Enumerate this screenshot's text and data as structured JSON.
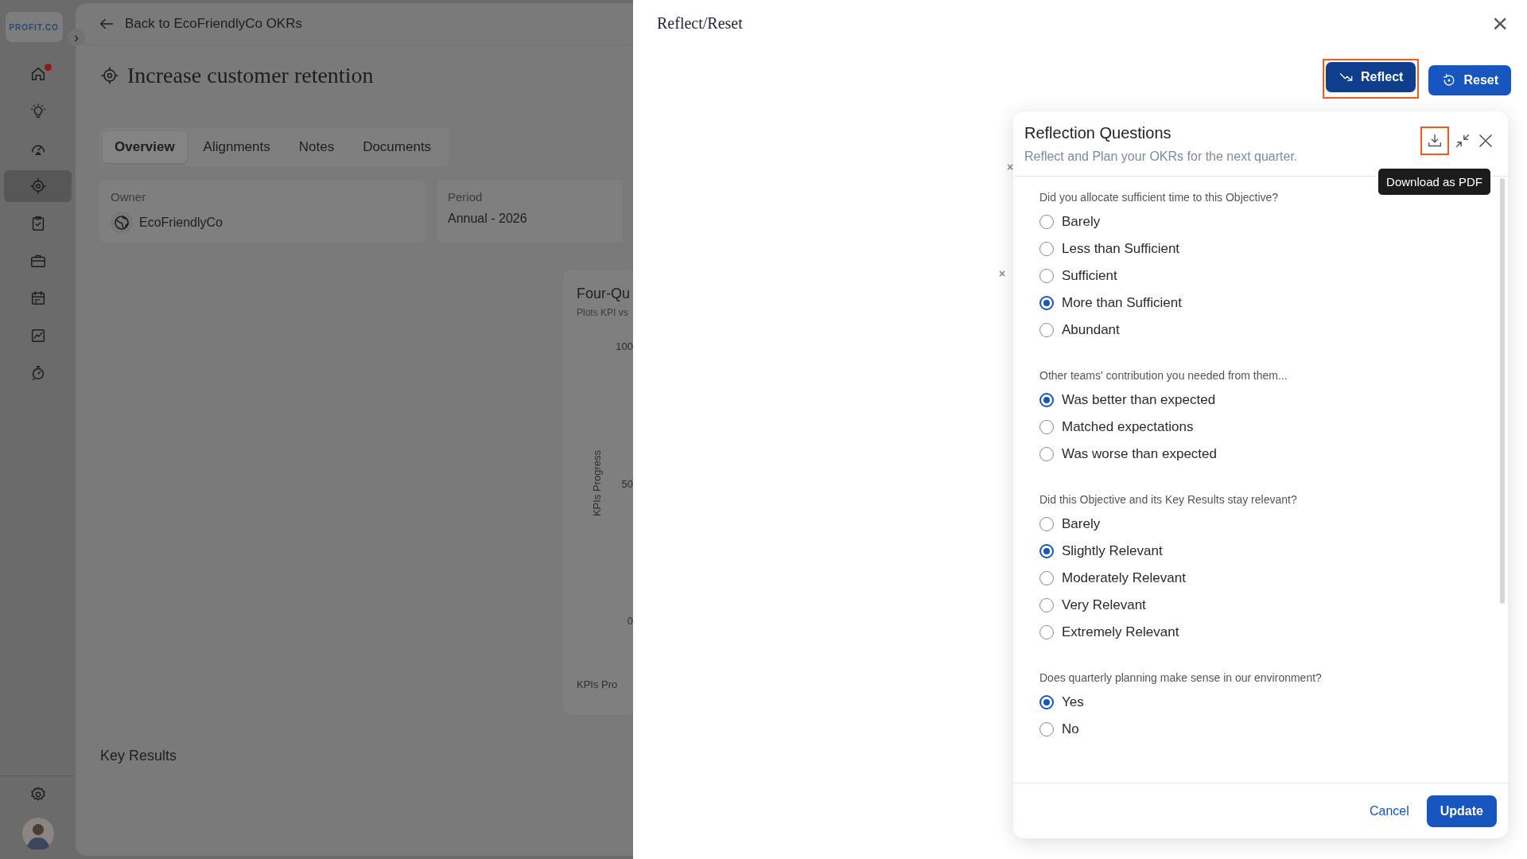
{
  "sidebar": {
    "logo": "PROFIT.CO",
    "expand_icon": "›",
    "items": [
      {
        "selected": false,
        "notification": true
      },
      {
        "selected": false,
        "notification": false
      },
      {
        "selected": false,
        "notification": false
      },
      {
        "selected": true,
        "notification": false
      },
      {
        "selected": false,
        "notification": false
      },
      {
        "selected": false,
        "notification": false
      },
      {
        "selected": false,
        "notification": false
      },
      {
        "selected": false,
        "notification": false
      },
      {
        "selected": false,
        "notification": false
      }
    ]
  },
  "page": {
    "back_link": "Back to EcoFriendlyCo OKRs",
    "title": "Increase customer retention",
    "tabs": [
      {
        "label": "Overview",
        "selected": true
      },
      {
        "label": "Alignments",
        "selected": false
      },
      {
        "label": "Notes",
        "selected": false
      },
      {
        "label": "Documents",
        "selected": false
      }
    ],
    "owner": {
      "label": "Owner",
      "value": "EcoFriendlyCo"
    },
    "period": {
      "label": "Period",
      "value": "Annual - 2026"
    },
    "chart_card": {
      "title": "Four-Qu",
      "subtitle": "Plots KPI vs",
      "y_axis_label": "KPIs Progress",
      "y_ticks": [
        "100",
        "50",
        "0"
      ],
      "legend": "KPIs Pro"
    },
    "key_results_heading": "Key Results"
  },
  "drawer": {
    "title": "Reflect/Reset",
    "close": "×",
    "background_marks": [
      "×",
      "×"
    ],
    "actions": [
      {
        "label": "Reflect",
        "kind": "reflect",
        "highlighted": true
      },
      {
        "label": "Reset",
        "kind": "reset",
        "highlighted": false
      }
    ],
    "panel": {
      "title": "Reflection Questions",
      "subtitle": "Reflect and Plan your OKRs for the next quarter.",
      "download_highlighted": true,
      "tooltip": "Download as PDF",
      "questions": [
        {
          "question": "Did you allocate sufficient time to this Objective?",
          "options": [
            {
              "label": "Barely",
              "selected": false
            },
            {
              "label": "Less than Sufficient",
              "selected": false
            },
            {
              "label": "Sufficient",
              "selected": false
            },
            {
              "label": "More than Sufficient",
              "selected": true
            },
            {
              "label": "Abundant",
              "selected": false
            }
          ]
        },
        {
          "question": "Other teams' contribution you needed from them...",
          "options": [
            {
              "label": "Was better than expected",
              "selected": true
            },
            {
              "label": "Matched expectations",
              "selected": false
            },
            {
              "label": "Was worse than expected",
              "selected": false
            }
          ]
        },
        {
          "question": "Did this Objective and its Key Results stay relevant?",
          "options": [
            {
              "label": "Barely",
              "selected": false
            },
            {
              "label": "Slightly Relevant",
              "selected": true
            },
            {
              "label": "Moderately Relevant",
              "selected": false
            },
            {
              "label": "Very Relevant",
              "selected": false
            },
            {
              "label": "Extremely Relevant",
              "selected": false
            }
          ]
        },
        {
          "question": "Does quarterly planning make sense in our environment?",
          "options": [
            {
              "label": "Yes",
              "selected": true
            },
            {
              "label": "No",
              "selected": false
            }
          ]
        }
      ],
      "buttons": {
        "cancel": "Cancel",
        "update": "Update"
      }
    }
  }
}
